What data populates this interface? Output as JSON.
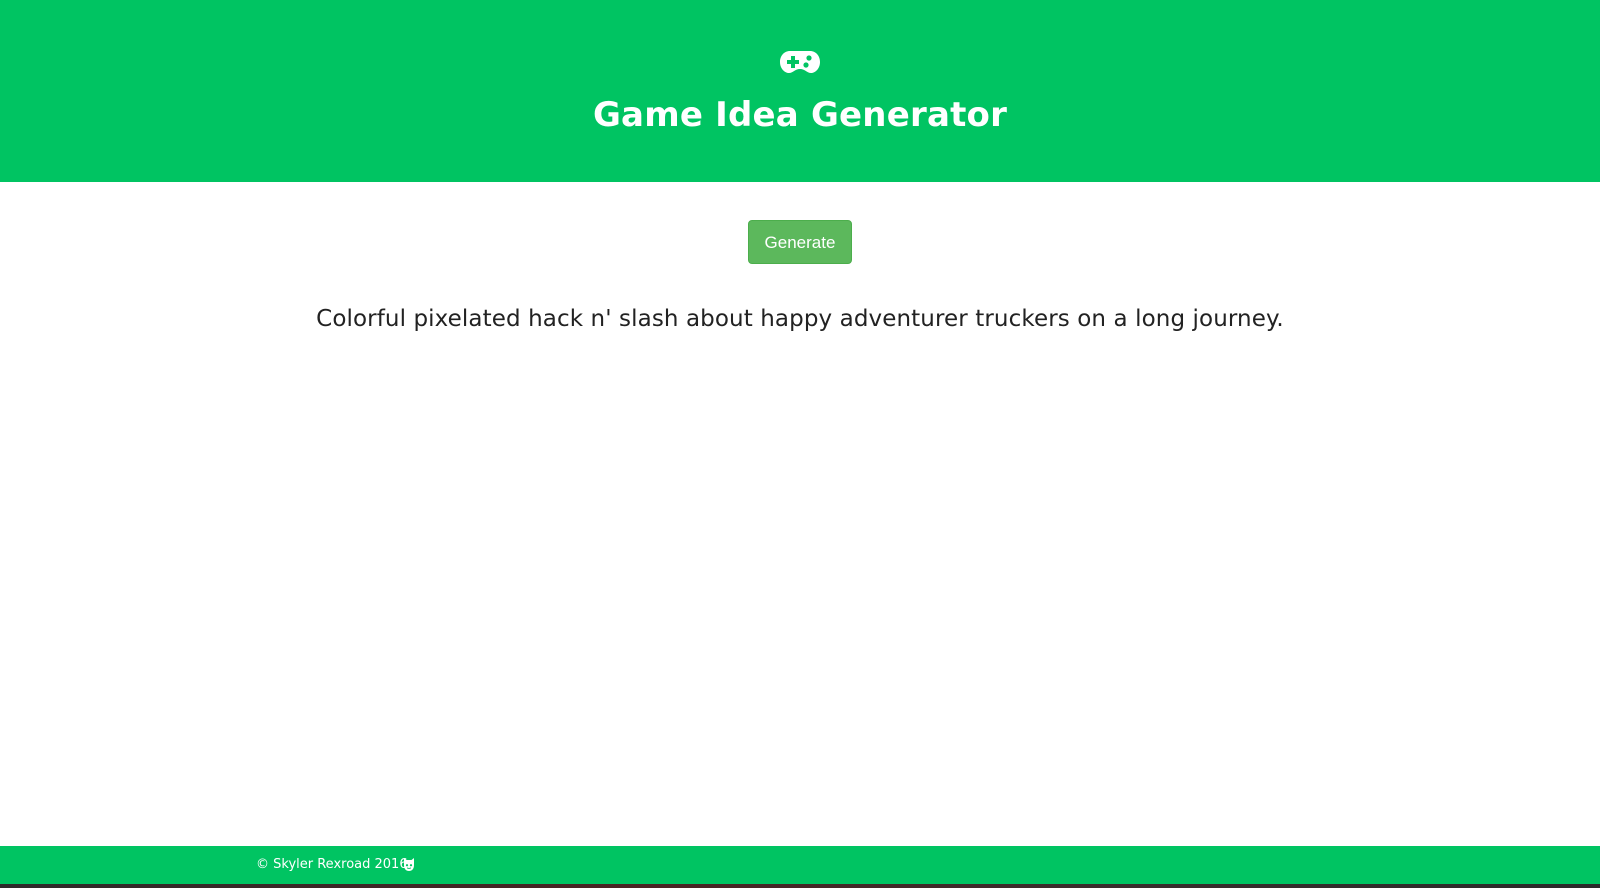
{
  "header": {
    "icon": "gamepad-icon",
    "title": "Game Idea Generator"
  },
  "main": {
    "generate_button_label": "Generate",
    "idea_text": "Colorful pixelated hack n' slash about happy adventurer truckers on a long journey."
  },
  "footer": {
    "copyright_text": "© Skyler Rexroad 2016",
    "icon": "github-icon"
  },
  "colors": {
    "brand_green": "#00c462",
    "button_green": "#5cb85c",
    "button_border": "#4cae4c",
    "text_dark": "#222222",
    "background": "#ffffff"
  }
}
